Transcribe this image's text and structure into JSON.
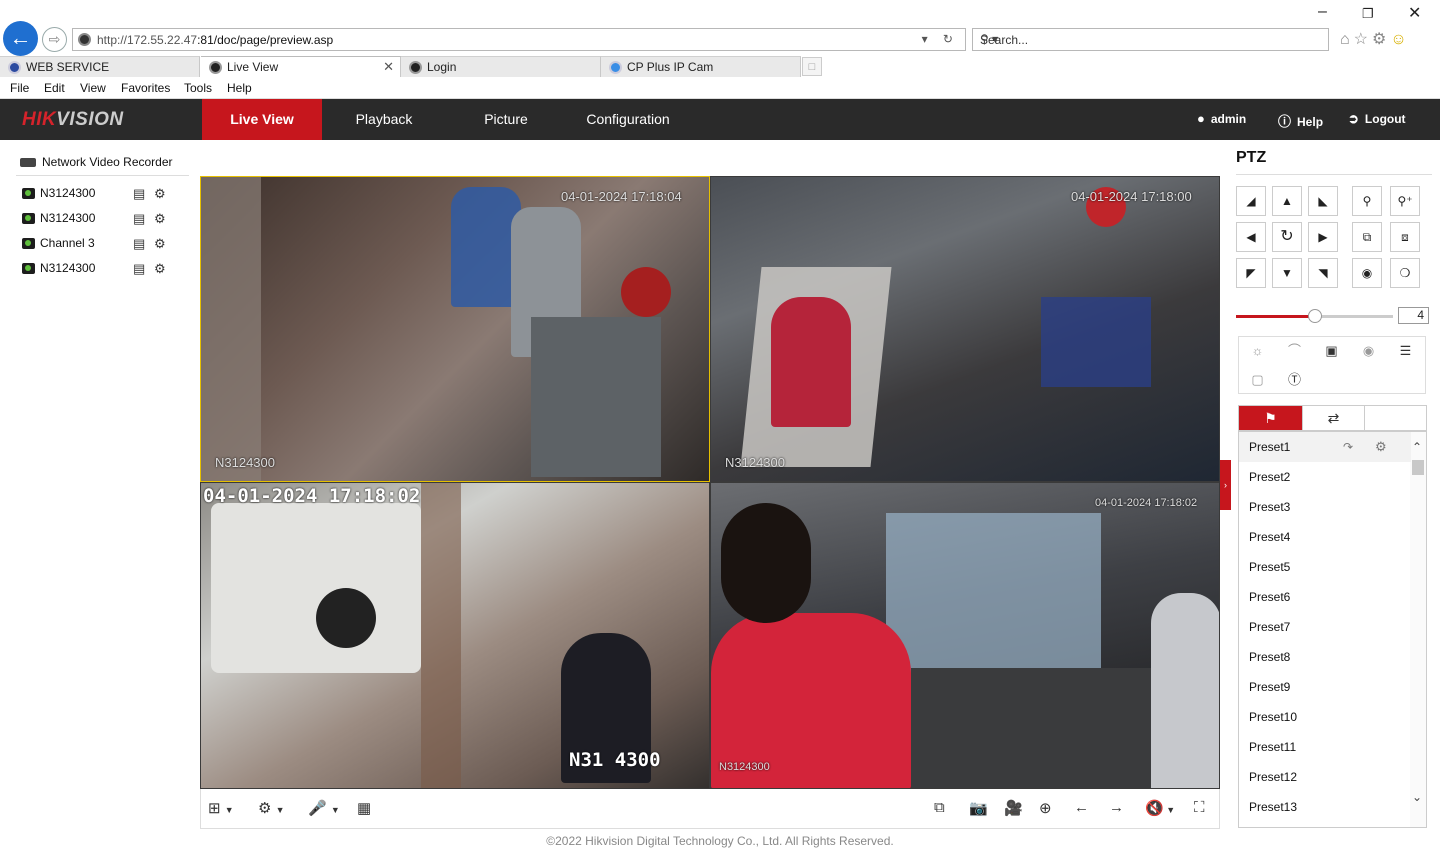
{
  "browser": {
    "url_host": "http://172.55.22.47",
    "url_path": ":81/doc/page/preview.asp",
    "search_placeholder": "Search...",
    "tabs": [
      {
        "label": "WEB SERVICE"
      },
      {
        "label": "Live View"
      },
      {
        "label": "Login"
      },
      {
        "label": "CP Plus IP Cam"
      }
    ],
    "menu": [
      "File",
      "Edit",
      "View",
      "Favorites",
      "Tools",
      "Help"
    ]
  },
  "app": {
    "brand_hik": "HIK",
    "brand_vision": "VISION",
    "nav": [
      "Live View",
      "Playback",
      "Picture",
      "Configuration"
    ],
    "active_nav": "Live View",
    "user": "admin",
    "help": "Help",
    "logout": "Logout",
    "accent_color": "#c6161d"
  },
  "device_tree": {
    "root": "Network Video Recorder",
    "channels": [
      {
        "label": "N3124300"
      },
      {
        "label": "N3124300"
      },
      {
        "label": "Channel 3"
      },
      {
        "label": "N3124300"
      }
    ]
  },
  "video": {
    "cells": [
      {
        "timestamp": "04-01-2024 17:18:04",
        "name": "N3124300"
      },
      {
        "timestamp": "04-01-2024 17:18:00",
        "name": "N3124300"
      },
      {
        "timestamp": "04-01-2024 17:18:02",
        "name": "N31 4300"
      },
      {
        "timestamp": "04-01-2024 17:18:02",
        "name": "N3124300"
      }
    ]
  },
  "ptz": {
    "title": "PTZ",
    "speed": "4",
    "speed_fraction": 0.5,
    "presets": [
      "Preset1",
      "Preset2",
      "Preset3",
      "Preset4",
      "Preset5",
      "Preset6",
      "Preset7",
      "Preset8",
      "Preset9",
      "Preset10",
      "Preset11",
      "Preset12",
      "Preset13"
    ]
  },
  "footer": "©2022 Hikvision Digital Technology Co., Ltd. All Rights Reserved."
}
